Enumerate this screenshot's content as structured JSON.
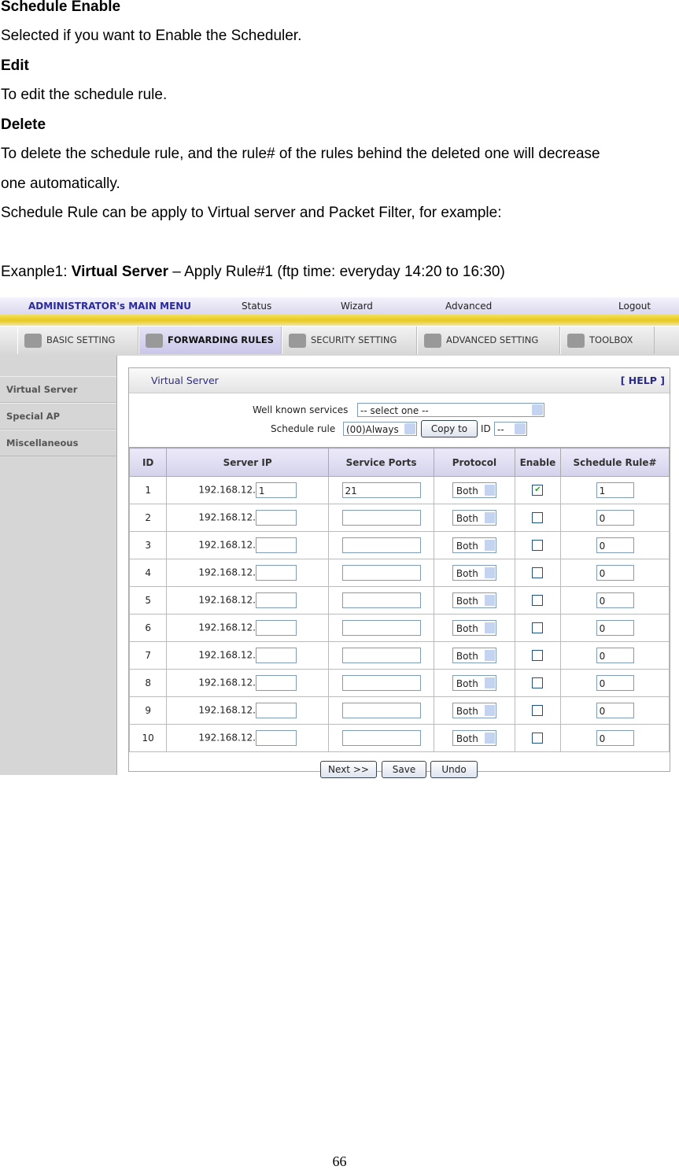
{
  "doc": {
    "h1": "Schedule Enable",
    "p1": "Selected if you want to Enable the Scheduler.",
    "h2": "Edit",
    "p2": "To edit the schedule rule.",
    "h3": "Delete",
    "p3a": "To delete the schedule rule, and the rule# of the rules behind the deleted one will decrease",
    "p3b": "one automatically.",
    "p4": "Schedule Rule can be apply to Virtual server and Packet Filter, for example:",
    "ex_prefix": "Exanple1: ",
    "ex_bold": "Virtual Server",
    "ex_suffix": " – Apply Rule#1 (ftp time: everyday 14:20 to 16:30)",
    "page_number": "66"
  },
  "ui": {
    "topnav": {
      "main": "ADMINISTRATOR's MAIN MENU",
      "status": "Status",
      "wizard": "Wizard",
      "advanced": "Advanced",
      "logout": "Logout"
    },
    "tabs": [
      {
        "label": "BASIC SETTING",
        "icon": "folder-icon"
      },
      {
        "label": "FORWARDING RULES",
        "icon": "arrows-icon",
        "active": true
      },
      {
        "label": "SECURITY SETTING",
        "icon": "lock-icon"
      },
      {
        "label": "ADVANCED SETTING",
        "icon": "tools-icon"
      },
      {
        "label": "TOOLBOX",
        "icon": "toolbox-icon"
      }
    ],
    "sidebar": [
      "Virtual Server",
      "Special AP",
      "Miscellaneous"
    ],
    "panel": {
      "title": "Virtual Server",
      "help": "[ HELP ]",
      "well_known_label": "Well known services",
      "well_known_value": "-- select one --",
      "schedule_label": "Schedule rule",
      "schedule_value": "(00)Always",
      "copy_to": "Copy to",
      "id_label": "ID",
      "id_value": "--"
    },
    "columns": [
      "ID",
      "Server IP",
      "Service Ports",
      "Protocol",
      "Enable",
      "Schedule Rule#"
    ],
    "ip_prefix": "192.168.12.",
    "rows": [
      {
        "id": "1",
        "ip": "1",
        "ports": "21",
        "protocol": "Both",
        "enabled": true,
        "rule": "1"
      },
      {
        "id": "2",
        "ip": "",
        "ports": "",
        "protocol": "Both",
        "enabled": false,
        "rule": "0"
      },
      {
        "id": "3",
        "ip": "",
        "ports": "",
        "protocol": "Both",
        "enabled": false,
        "rule": "0"
      },
      {
        "id": "4",
        "ip": "",
        "ports": "",
        "protocol": "Both",
        "enabled": false,
        "rule": "0"
      },
      {
        "id": "5",
        "ip": "",
        "ports": "",
        "protocol": "Both",
        "enabled": false,
        "rule": "0"
      },
      {
        "id": "6",
        "ip": "",
        "ports": "",
        "protocol": "Both",
        "enabled": false,
        "rule": "0"
      },
      {
        "id": "7",
        "ip": "",
        "ports": "",
        "protocol": "Both",
        "enabled": false,
        "rule": "0"
      },
      {
        "id": "8",
        "ip": "",
        "ports": "",
        "protocol": "Both",
        "enabled": false,
        "rule": "0"
      },
      {
        "id": "9",
        "ip": "",
        "ports": "",
        "protocol": "Both",
        "enabled": false,
        "rule": "0"
      },
      {
        "id": "10",
        "ip": "",
        "ports": "",
        "protocol": "Both",
        "enabled": false,
        "rule": "0"
      }
    ],
    "buttons": {
      "next": "Next >>",
      "save": "Save",
      "undo": "Undo"
    }
  }
}
